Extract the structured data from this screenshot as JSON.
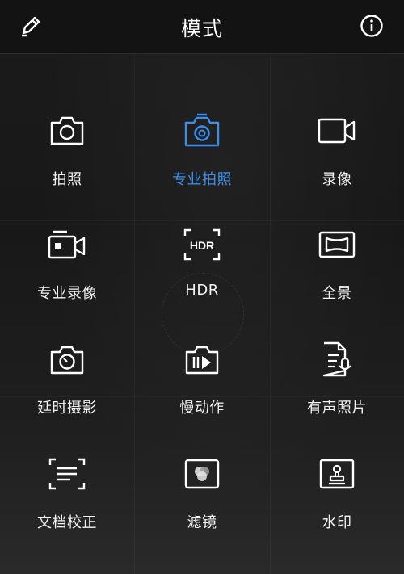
{
  "header": {
    "title": "模式",
    "edit_icon": "pencil-icon",
    "info_icon": "info-icon"
  },
  "accent_color": "#3b8ee9",
  "modes": [
    {
      "label": "拍照",
      "icon": "camera-icon",
      "active": false
    },
    {
      "label": "专业拍照",
      "icon": "pro-camera-icon",
      "active": true
    },
    {
      "label": "录像",
      "icon": "video-camera-icon",
      "active": false
    },
    {
      "label": "专业录像",
      "icon": "pro-video-icon",
      "active": false
    },
    {
      "label": "HDR",
      "icon": "hdr-icon",
      "active": false
    },
    {
      "label": "全景",
      "icon": "panorama-icon",
      "active": false
    },
    {
      "label": "延时摄影",
      "icon": "timelapse-icon",
      "active": false
    },
    {
      "label": "慢动作",
      "icon": "slow-motion-icon",
      "active": false
    },
    {
      "label": "有声照片",
      "icon": "audio-photo-icon",
      "active": false
    },
    {
      "label": "文档校正",
      "icon": "document-scan-icon",
      "active": false
    },
    {
      "label": "滤镜",
      "icon": "filter-icon",
      "active": false
    },
    {
      "label": "水印",
      "icon": "watermark-icon",
      "active": false
    }
  ]
}
